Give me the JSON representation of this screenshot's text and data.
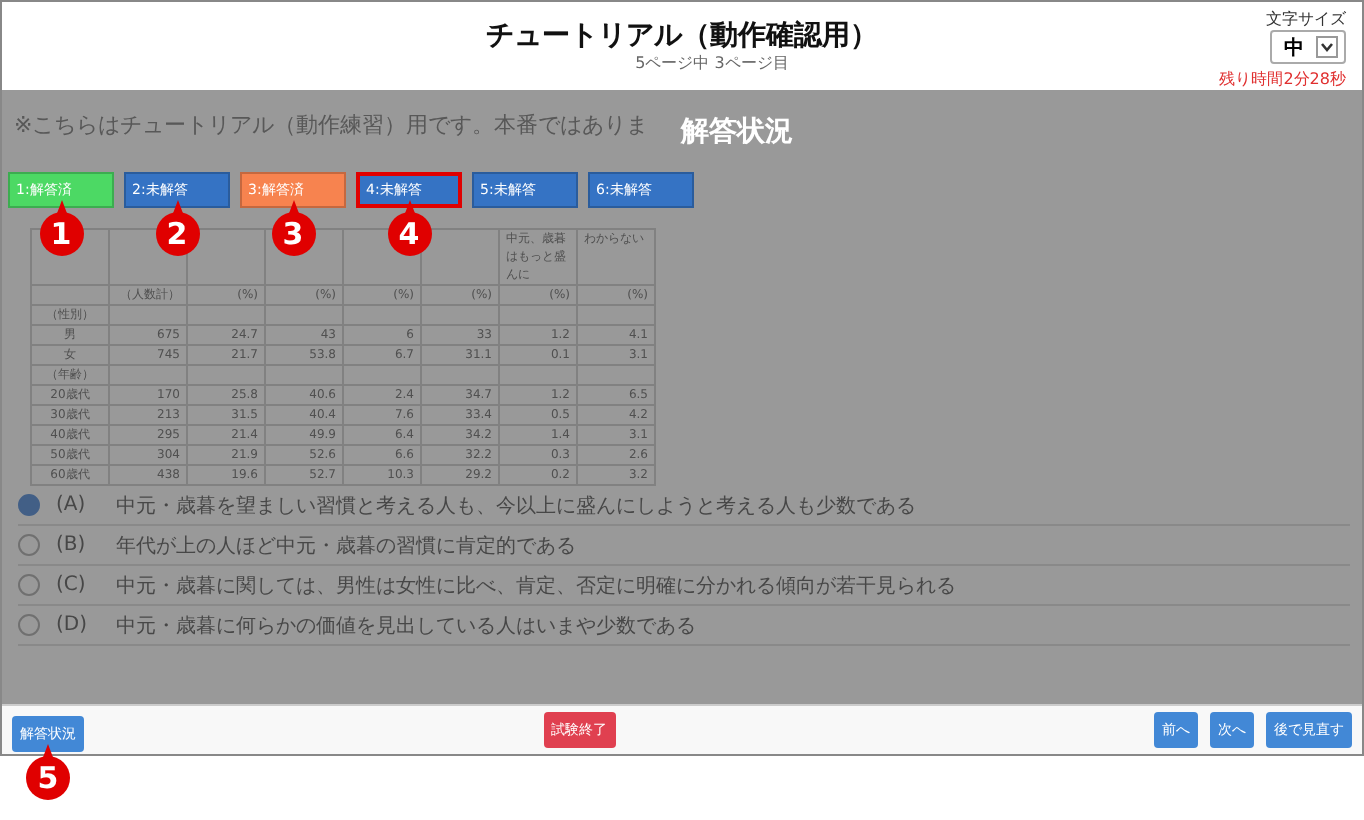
{
  "header": {
    "title": "チュートリアル（動作確認用）",
    "subtitle": "5ページ中 3ページ目",
    "font_size": {
      "label": "文字サイズ",
      "value": "中"
    },
    "time_left": "残り時間2分28秒"
  },
  "background": {
    "notice": "※こちらはチュートリアル（動作練習）用です。本番ではありま",
    "table": {
      "headings": [
        {
          "unit": "（人数計）"
        },
        {
          "unit": "(%)"
        },
        {
          "unit": "(%)"
        },
        {
          "unit": "(%)"
        },
        {
          "unit": "(%)"
        },
        {
          "heading": "中元、歳暮はもっと盛んに",
          "unit": "(%)"
        },
        {
          "heading": "わからない",
          "unit": "(%)"
        }
      ],
      "rows": [
        [
          "（性別）",
          "",
          "",
          "",
          "",
          "",
          "",
          ""
        ],
        [
          "男",
          "675",
          "24.7",
          "43",
          "6",
          "33",
          "1.2",
          "4.1"
        ],
        [
          "女",
          "745",
          "21.7",
          "53.8",
          "6.7",
          "31.1",
          "0.1",
          "3.1"
        ],
        [
          "（年齢）",
          "",
          "",
          "",
          "",
          "",
          "",
          ""
        ],
        [
          "20歳代",
          "170",
          "25.8",
          "40.6",
          "2.4",
          "34.7",
          "1.2",
          "6.5"
        ],
        [
          "30歳代",
          "213",
          "31.5",
          "40.4",
          "7.6",
          "33.4",
          "0.5",
          "4.2"
        ],
        [
          "40歳代",
          "295",
          "21.4",
          "49.9",
          "6.4",
          "34.2",
          "1.4",
          "3.1"
        ],
        [
          "50歳代",
          "304",
          "21.9",
          "52.6",
          "6.6",
          "32.2",
          "0.3",
          "2.6"
        ],
        [
          "60歳代",
          "438",
          "19.6",
          "52.7",
          "10.3",
          "29.2",
          "0.2",
          "3.2"
        ]
      ]
    },
    "choices": [
      {
        "letter": "(A)",
        "text": "中元・歳暮を望ましい習慣と考える人も、今以上に盛んにしようと考える人も少数である",
        "selected": true
      },
      {
        "letter": "(B)",
        "text": "年代が上の人ほど中元・歳暮の習慣に肯定的である",
        "selected": false
      },
      {
        "letter": "(C)",
        "text": "中元・歳暮に関しては、男性は女性に比べ、肯定、否定に明確に分かれる傾向が若干見られる",
        "selected": false
      },
      {
        "letter": "(D)",
        "text": "中元・歳暮に何らかの価値を見出している人はいまや少数である",
        "selected": false
      }
    ]
  },
  "status_panel": {
    "title": "解答状況",
    "questions": [
      {
        "label": "1:解答済",
        "color": "#4cd964",
        "current": false,
        "callout": "1"
      },
      {
        "label": "2:未解答",
        "color": "#3573c4",
        "current": false,
        "callout": "2"
      },
      {
        "label": "3:解答済",
        "color": "#f7834f",
        "current": false,
        "callout": "3"
      },
      {
        "label": "4:未解答",
        "color": "#3573c4",
        "current": true,
        "callout": "4"
      },
      {
        "label": "5:未解答",
        "color": "#3573c4",
        "current": false
      },
      {
        "label": "6:未解答",
        "color": "#3573c4",
        "current": false
      }
    ]
  },
  "footer": {
    "left": {
      "label": "解答状況",
      "callout": "5"
    },
    "center": {
      "label": "試験終了"
    },
    "right": [
      {
        "label": "前へ"
      },
      {
        "label": "次へ"
      },
      {
        "label": "後で見直す"
      }
    ]
  }
}
